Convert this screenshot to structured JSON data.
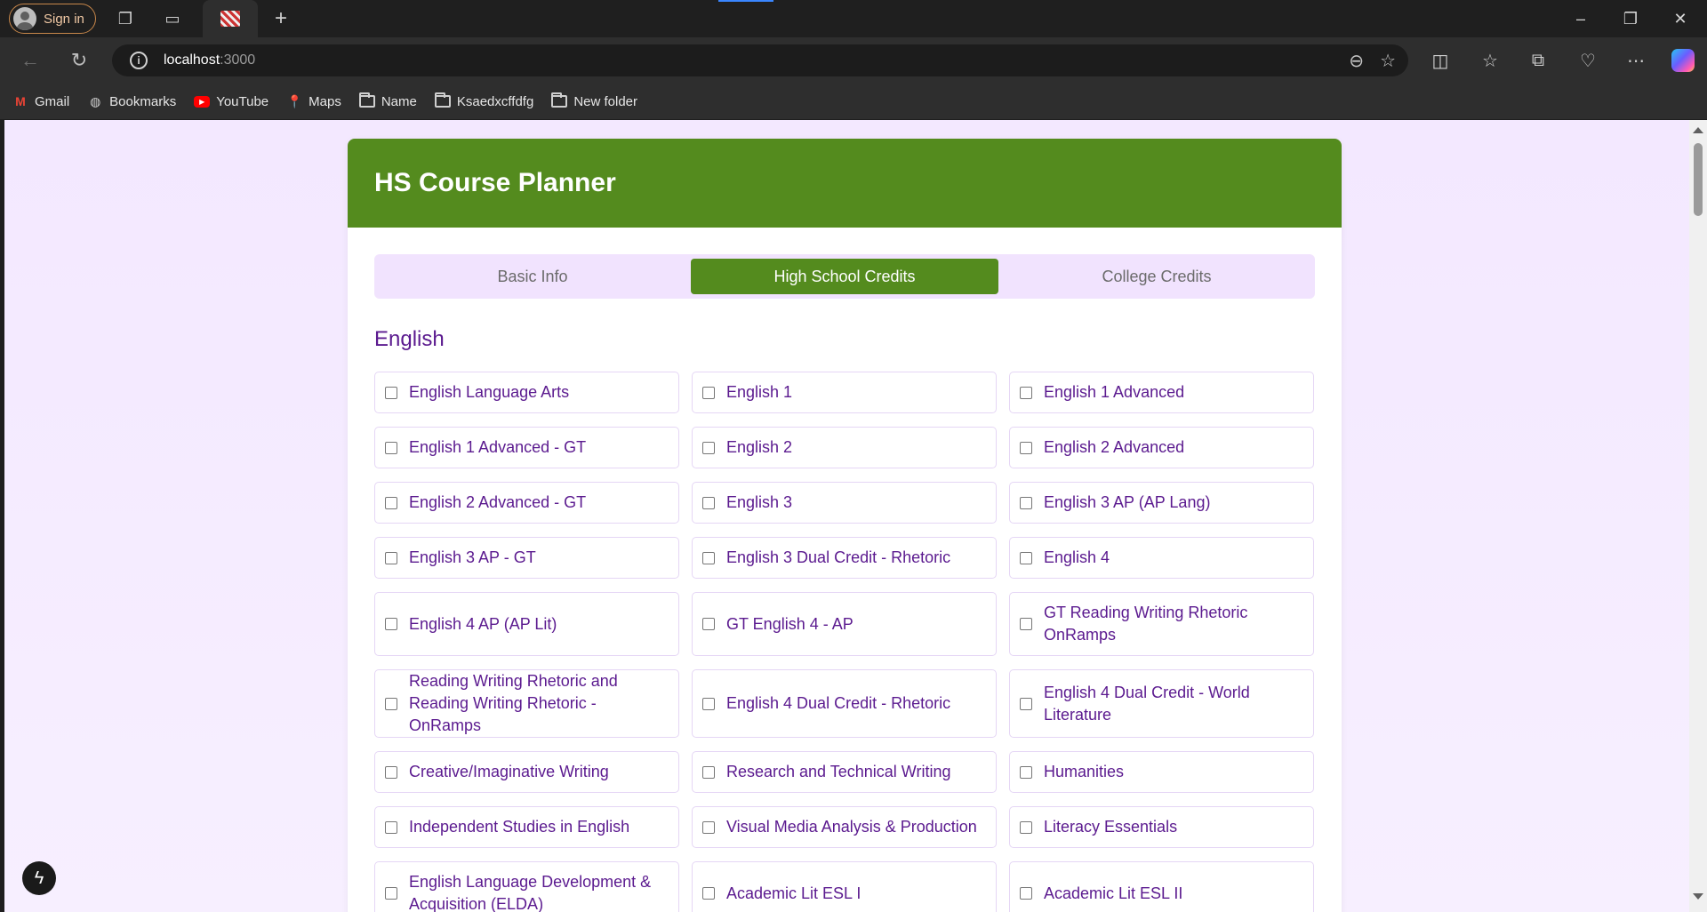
{
  "browser": {
    "signin_label": "Sign in",
    "url_host": "localhost",
    "url_port": ":3000",
    "bookmarks": [
      {
        "label": "Gmail",
        "icon": "gmail-icon"
      },
      {
        "label": "Bookmarks",
        "icon": "globe-icon"
      },
      {
        "label": "YouTube",
        "icon": "youtube-icon"
      },
      {
        "label": "Maps",
        "icon": "maps-icon"
      },
      {
        "label": "Name",
        "icon": "folder-icon"
      },
      {
        "label": "Ksaedxcffdfg",
        "icon": "folder-icon"
      },
      {
        "label": "New folder",
        "icon": "folder-icon"
      }
    ]
  },
  "app": {
    "title": "HS Course Planner",
    "tabs": [
      {
        "label": "Basic Info",
        "active": false
      },
      {
        "label": "High School Credits",
        "active": true
      },
      {
        "label": "College Credits",
        "active": false
      }
    ],
    "section": "English",
    "courses": [
      {
        "label": "English Language Arts",
        "checked": false
      },
      {
        "label": "English 1",
        "checked": false
      },
      {
        "label": "English 1 Advanced",
        "checked": false
      },
      {
        "label": "English 1 Advanced - GT",
        "checked": false
      },
      {
        "label": "English 2",
        "checked": false
      },
      {
        "label": "English 2 Advanced",
        "checked": false
      },
      {
        "label": "English 2 Advanced - GT",
        "checked": false
      },
      {
        "label": "English 3",
        "checked": false
      },
      {
        "label": "English 3 AP (AP Lang)",
        "checked": false
      },
      {
        "label": "English 3 AP - GT",
        "checked": false
      },
      {
        "label": "English 3 Dual Credit - Rhetoric",
        "checked": false
      },
      {
        "label": "English 4",
        "checked": false
      },
      {
        "label": "English 4 AP (AP Lit)",
        "checked": false
      },
      {
        "label": "GT English 4 - AP",
        "checked": false
      },
      {
        "label": "GT Reading Writing Rhetoric OnRamps",
        "checked": false
      },
      {
        "label": "Reading Writing Rhetoric and Reading Writing Rhetoric - OnRamps",
        "checked": false
      },
      {
        "label": "English 4 Dual Credit - Rhetoric",
        "checked": false
      },
      {
        "label": "English 4 Dual Credit - World Literature",
        "checked": false
      },
      {
        "label": "Creative/Imaginative Writing",
        "checked": false
      },
      {
        "label": "Research and Technical Writing",
        "checked": false
      },
      {
        "label": "Humanities",
        "checked": false
      },
      {
        "label": "Independent Studies in English",
        "checked": false
      },
      {
        "label": "Visual Media Analysis & Production",
        "checked": false
      },
      {
        "label": "Literacy Essentials",
        "checked": false
      },
      {
        "label": "English Language Development & Acquisition (ELDA)",
        "checked": false
      },
      {
        "label": "Academic Lit ESL I",
        "checked": false
      },
      {
        "label": "Academic Lit ESL II",
        "checked": false
      }
    ]
  },
  "colors": {
    "header_green": "#548b1e",
    "text_purple": "#5b1a8f",
    "page_bg": "#f3e8ff"
  }
}
